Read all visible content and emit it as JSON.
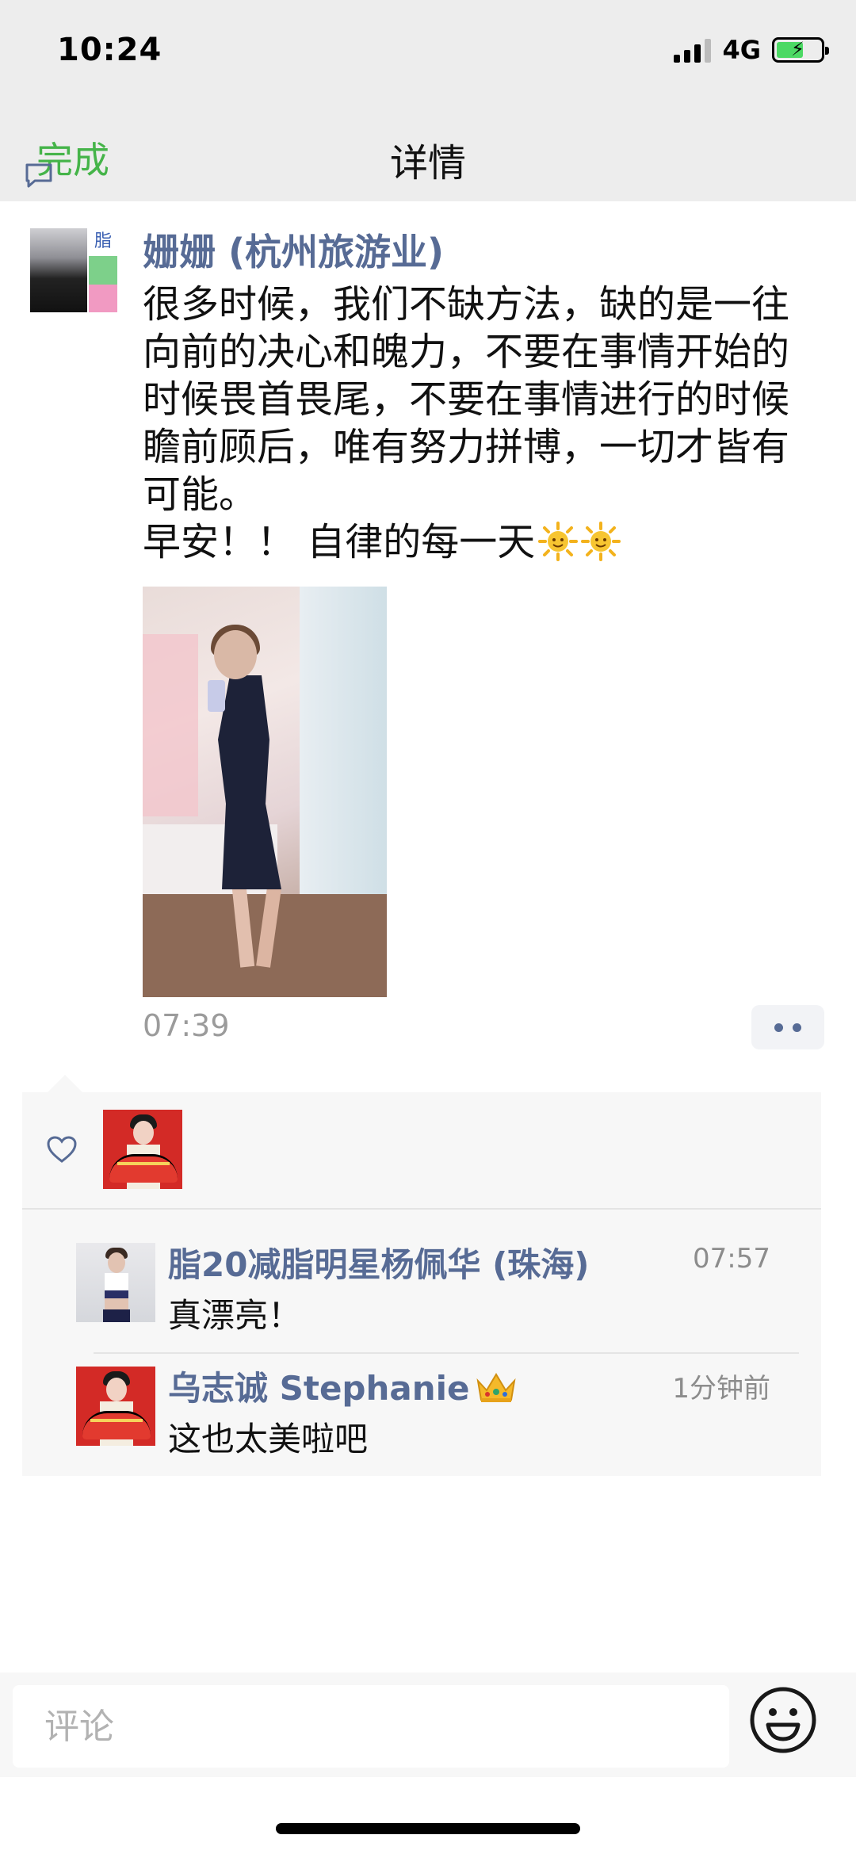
{
  "status_bar": {
    "time": "10:24",
    "network": "4G"
  },
  "nav": {
    "done_label": "完成",
    "title": "详情"
  },
  "post": {
    "author": "姗姗 (杭州旅游业)",
    "text_lines": [
      "很多时候，我们不缺方法，缺的是一往",
      "向前的决心和魄力，不要在事情开始的",
      "时候畏首畏尾，不要在事情进行的时候",
      "瞻前顾后，唯有努力拼博，一切才皆有",
      "可能。"
    ],
    "greeting": "早安！！ 自律的每一天",
    "greeting_icons": [
      "sun-icon",
      "sun-icon"
    ],
    "time": "07:39"
  },
  "interactions": {
    "comments": [
      {
        "name": "脂20减脂明星杨佩华 (珠海)",
        "time": "07:57",
        "text": "真漂亮！"
      },
      {
        "name": "乌志诚 Stephanie",
        "name_icon": "crown-icon",
        "time": "1分钟前",
        "text": "这也太美啦吧"
      }
    ]
  },
  "comment_bar": {
    "placeholder": "评论"
  },
  "colors": {
    "link_blue": "#576b95",
    "done_green": "#45b449",
    "nav_bg": "#ededed",
    "panel_bg": "#f7f7f7"
  }
}
